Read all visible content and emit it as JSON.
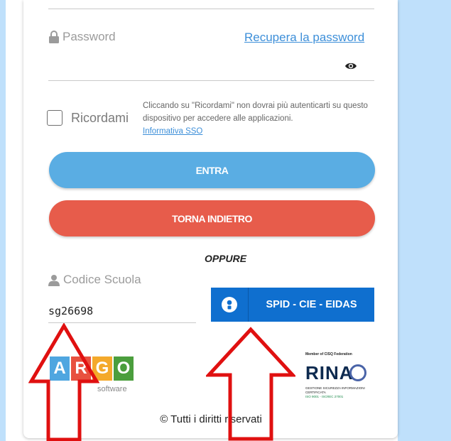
{
  "password": {
    "label": "Password",
    "recover_link": "Recupera la password"
  },
  "remember": {
    "label": "Ricordami",
    "note": "Cliccando su \"Ricordami\" non dovrai più autenticarti su questo dispositivo per accedere alle applicazioni.",
    "link": "Informativa SSO"
  },
  "buttons": {
    "enter": "ENTRA",
    "back": "TORNA INDIETRO"
  },
  "separator": "OPPURE",
  "school": {
    "label": "Codice Scuola",
    "value": "sg26698"
  },
  "spid": {
    "label": "SPID - CIE - EIDAS"
  },
  "argo": {
    "letters": [
      "A",
      "R",
      "G",
      "O"
    ],
    "subtitle": "software"
  },
  "rina": {
    "top_text": "Member of CISQ Federation",
    "word": "RINA",
    "small_text": "GESTIONE SICUREZZA INFORMAZIONI CERTIFICATA",
    "iso": "ISO 9001 - ISO/IEC 27001"
  },
  "footer": "© Tutti i diritti riservati",
  "colors": {
    "enter": "#5aade3",
    "back": "#e75c4b",
    "spid": "#0f6fcf",
    "link": "#3d8fd9",
    "arrow": "#e01010",
    "background": "#bfe0fb",
    "argo_tiles": [
      "#4fa6e0",
      "#e8513f",
      "#f4a92b",
      "#4b9e3d"
    ]
  }
}
